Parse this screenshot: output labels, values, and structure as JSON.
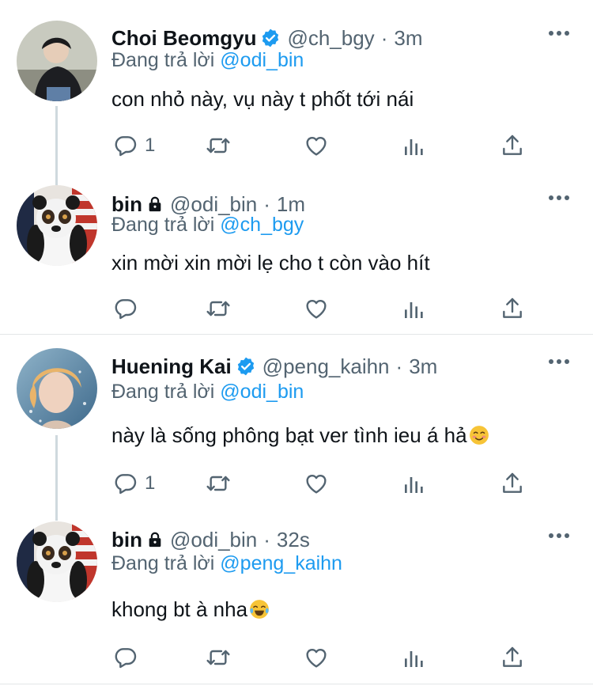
{
  "colors": {
    "accent": "#1d9bf0",
    "muted": "#536471",
    "text": "#0f1419",
    "divider": "#e3e6e8"
  },
  "reply_prefix": "Đang trả lời",
  "tweets": [
    {
      "name": "Choi Beomgyu",
      "verified": true,
      "handle": "@ch_bgy",
      "time": "3m",
      "reply_to": "@odi_bin",
      "text": "con nhỏ này, vụ này t phốt tới nái",
      "reply_count": "1"
    },
    {
      "name": "bin",
      "locked": true,
      "handle": "@odi_bin",
      "time": "1m",
      "reply_to": "@ch_bgy",
      "text": "xin mời xin mời lẹ cho t còn vào hít",
      "reply_count": ""
    },
    {
      "name": "Huening Kai",
      "verified": true,
      "handle": "@peng_kaihn",
      "time": "3m",
      "reply_to": "@odi_bin",
      "text": "này là sống phông bạt ver tình ieu á hả",
      "emoji": "smiling-face-emoji",
      "reply_count": "1"
    },
    {
      "name": "bin",
      "locked": true,
      "handle": "@odi_bin",
      "time": "32s",
      "reply_to": "@peng_kaihn",
      "text": "khong bt à nha",
      "emoji": "tears-of-joy-emoji",
      "reply_count": ""
    }
  ],
  "icons": {
    "reply": "reply-icon",
    "retweet": "retweet-icon",
    "like": "like-icon",
    "stats": "stats-icon",
    "share": "share-icon",
    "more": "more-icon",
    "verified": "verified-badge-icon",
    "lock": "lock-icon"
  }
}
